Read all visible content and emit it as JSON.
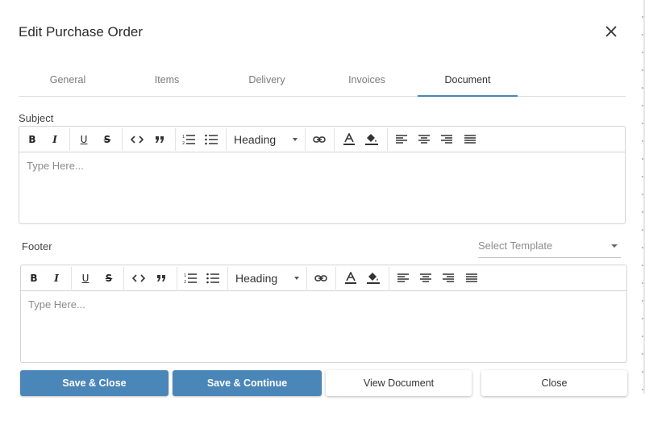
{
  "dialog": {
    "title": "Edit Purchase Order",
    "close_icon": "close-icon"
  },
  "tabs": [
    {
      "label": "General",
      "active": false
    },
    {
      "label": "Items",
      "active": false
    },
    {
      "label": "Delivery",
      "active": false
    },
    {
      "label": "Invoices",
      "active": false
    },
    {
      "label": "Document",
      "active": true
    }
  ],
  "subject": {
    "label": "Subject",
    "heading_label": "Heading",
    "placeholder": "Type Here..."
  },
  "footer": {
    "label": "Footer",
    "heading_label": "Heading",
    "placeholder": "Type Here...",
    "template_select": "Select Template"
  },
  "toolbar": {
    "bold": "B",
    "italic": "I",
    "underline": "U",
    "strikethrough": "S"
  },
  "buttons": {
    "save_close": "Save & Close",
    "save_continue": "Save & Continue",
    "view_document": "View Document",
    "close": "Close"
  },
  "colors": {
    "accent": "#4a86b8"
  }
}
